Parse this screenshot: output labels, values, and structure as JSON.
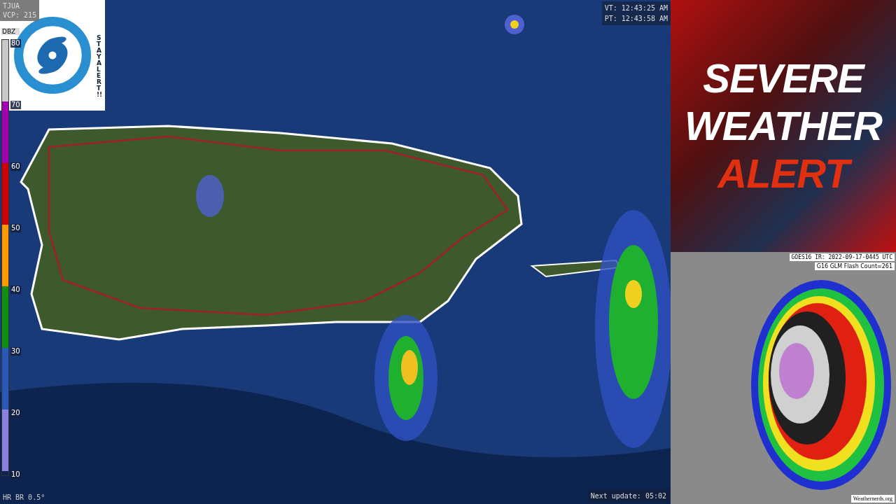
{
  "radar": {
    "station": "TJUA",
    "vcp": "VCP: 215",
    "valid_time": "VT: 12:43:25 AM",
    "process_time": "PT: 12:43:58 AM",
    "product": "HR BR 0.5°",
    "next_update": "Next update: 05:02"
  },
  "logo": {
    "text": "STAY ALERT !!"
  },
  "legend": {
    "title": "DBZ",
    "labels": [
      "80",
      "70",
      "60",
      "50",
      "40",
      "30",
      "20",
      "10"
    ],
    "bands": [
      {
        "color": "#c8c8c8"
      },
      {
        "color": "#a000b0"
      },
      {
        "color": "#d00000"
      },
      {
        "color": "#ff9900"
      },
      {
        "color": "#109010"
      },
      {
        "color": "#2858b8"
      },
      {
        "color": "#8a80e0"
      }
    ]
  },
  "banner": {
    "lines": [
      "SEVERE",
      "WEATHER",
      "ALERT"
    ]
  },
  "satellite": {
    "title": "GOES16 IR: 2022-09-17-0445 UTC",
    "subtitle": "G16 GLM Flash Count=261",
    "credit": "Weathernerds.org"
  }
}
